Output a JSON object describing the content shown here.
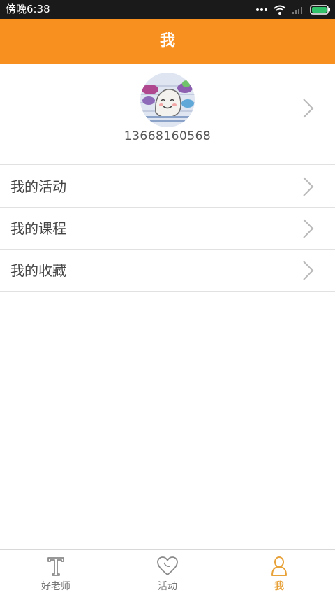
{
  "status_bar": {
    "time": "傍晚6:38",
    "icons": [
      "dots-icon",
      "wifi-icon",
      "signal-icon",
      "battery-icon"
    ]
  },
  "header": {
    "title": "我",
    "accent_color": "#f7901e"
  },
  "profile": {
    "phone": "13668160568",
    "avatar_icon": "avatar"
  },
  "menu": {
    "items": [
      {
        "label": "我的活动"
      },
      {
        "label": "我的课程"
      },
      {
        "label": "我的收藏"
      }
    ]
  },
  "tab_bar": {
    "tabs": [
      {
        "label": "好老师",
        "icon": "teacher-icon",
        "active": false
      },
      {
        "label": "活动",
        "icon": "heart-icon",
        "active": false
      },
      {
        "label": "我",
        "icon": "person-icon",
        "active": true
      }
    ],
    "active_color": "#e8a23a"
  }
}
